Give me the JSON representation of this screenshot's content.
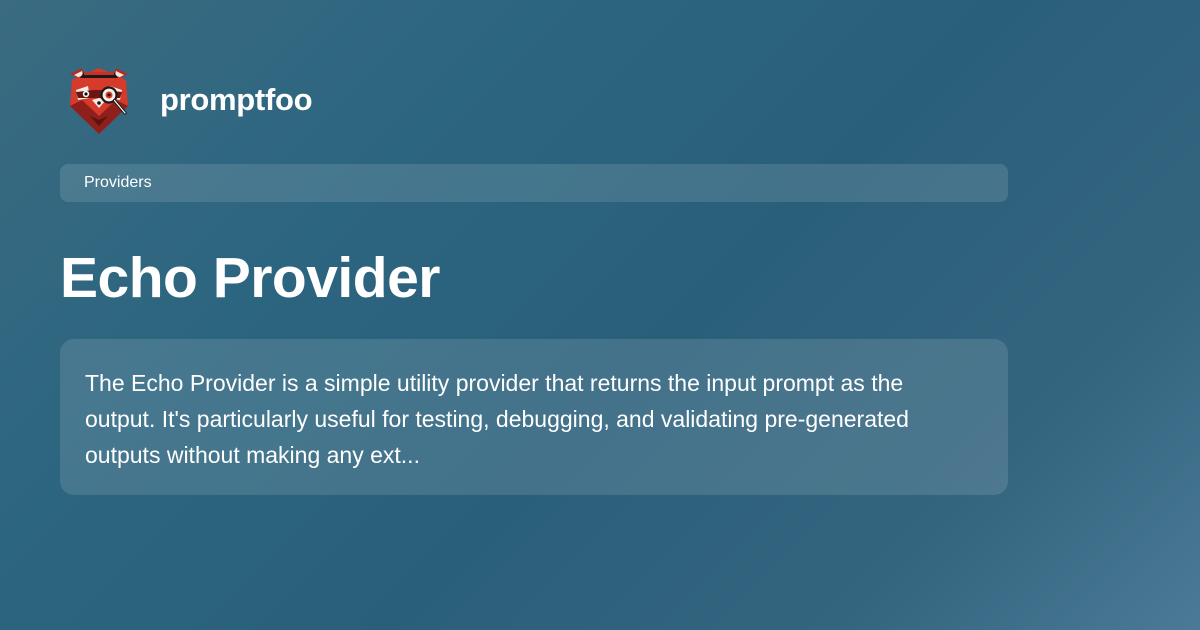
{
  "brand": {
    "name": "promptfoo",
    "logo_icon": "red-panda-detective-logo-icon"
  },
  "category": {
    "label": "Providers"
  },
  "page": {
    "title": "Echo Provider",
    "description": "The Echo Provider is a simple utility provider that returns the input prompt as the output. It's particularly useful for testing, debugging, and validating pre-generated outputs without making any ext..."
  },
  "colors": {
    "background_start": "#3a6b80",
    "background_end": "#4a7a96",
    "logo_red": "#d63a2a",
    "logo_dark_red": "#8e1f1a",
    "text": "#ffffff"
  }
}
